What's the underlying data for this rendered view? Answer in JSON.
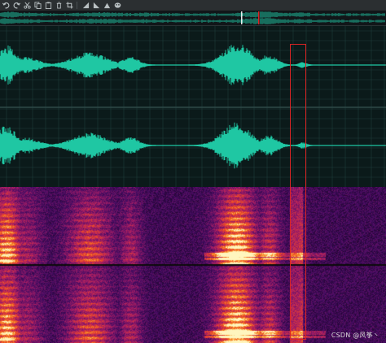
{
  "toolbar": {
    "icons": [
      "undo-icon",
      "redo-icon",
      "cut-icon",
      "copy-icon",
      "paste-icon",
      "delete-icon",
      "crop-icon",
      "fade-in-icon",
      "fade-out-icon",
      "normalize-icon",
      "effects-icon"
    ]
  },
  "colors": {
    "waveform": "#1fc7a3",
    "waveform_bg": "#0b1a1a",
    "grid": "#1f3d3a",
    "selection": "#d92424",
    "spectrogram_low": "#12031c",
    "spectrogram_high": "#fff0b0"
  },
  "watermark": "CSDN @风筝丶"
}
